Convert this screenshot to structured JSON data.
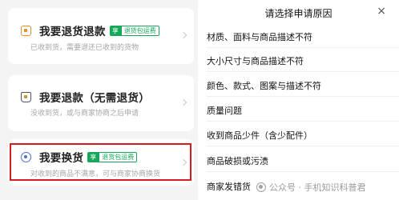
{
  "return_options": [
    {
      "title": "我要退货退款",
      "badge_a": "享",
      "badge_b": "退货包运费",
      "desc": "已收到货，需要退还已收到的货物",
      "icon": "return-box-icon"
    },
    {
      "title": "我要退款（无需退货）",
      "desc": "没收到货，或与商家协商之后申请",
      "icon": "refund-bag-icon"
    },
    {
      "title": "我要换货",
      "badge_a": "享",
      "badge_b": "退货包运费",
      "desc": "对收到的商品不满意，可与商家协商换货",
      "icon": "exchange-icon"
    }
  ],
  "reason_panel": {
    "title": "请选择申请原因",
    "close_glyph": "×",
    "reasons": [
      "材质、面料与商品描述不符",
      "大小尺寸与商品描述不符",
      "颜色、款式、图案与描述不符",
      "质量问题",
      "收到商品少件（含少配件）",
      "商品破损或污渍",
      "商家发错货"
    ]
  },
  "watermark": "公众号 · 手机知识科普君",
  "colors": {
    "highlight": "#d71c21",
    "badge_green": "#16a85a"
  }
}
